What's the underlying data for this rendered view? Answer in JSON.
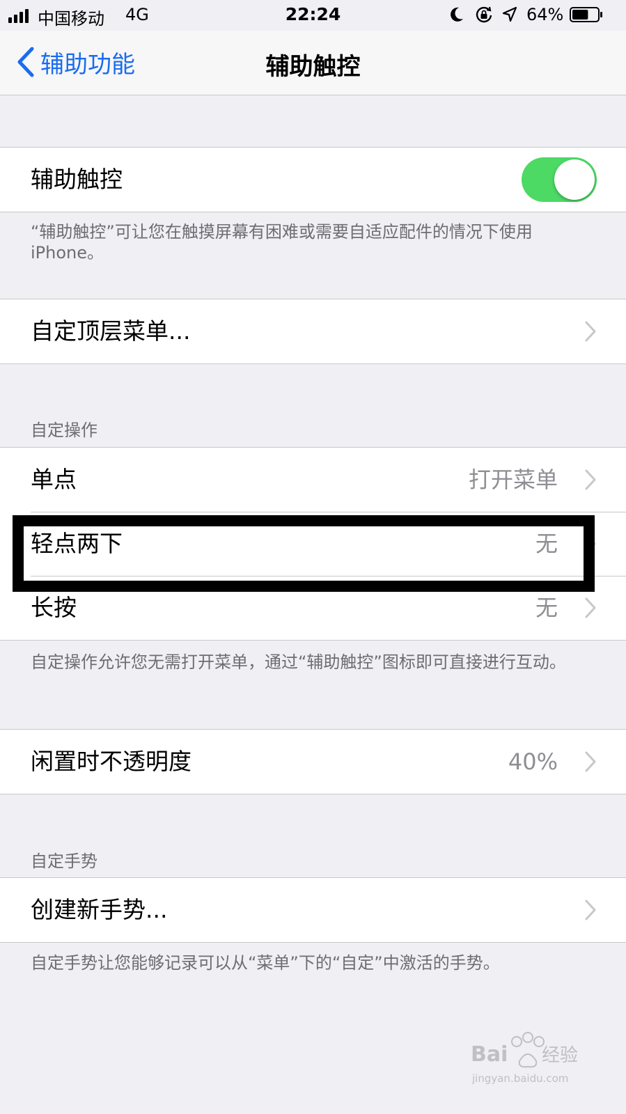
{
  "status_bar": {
    "carrier": "中国移动",
    "network": "4G",
    "time": "22:24",
    "battery": "64%",
    "battery_level": 0.64
  },
  "nav": {
    "back_label": "辅助功能",
    "title": "辅助触控"
  },
  "assistive_touch": {
    "label": "辅助触控",
    "enabled": true,
    "footer": "“辅助触控”可让您在触摸屏幕有困难或需要自适应配件的情况下使用 iPhone。"
  },
  "top_menu": {
    "label": "自定顶层菜单..."
  },
  "custom_actions": {
    "header": "自定操作",
    "items": [
      {
        "label": "单点",
        "value": "打开菜单"
      },
      {
        "label": "轻点两下",
        "value": "无"
      },
      {
        "label": "长按",
        "value": "无"
      }
    ],
    "footer": "自定操作允许您无需打开菜单，通过“辅助触控”图标即可直接进行互动。"
  },
  "idle_opacity": {
    "label": "闲置时不透明度",
    "value": "40%"
  },
  "custom_gestures": {
    "header": "自定手势",
    "create_label": "创建新手势...",
    "footer": "自定手势让您能够记录可以从“菜单”下的“自定”中激活的手势。"
  },
  "watermark": {
    "brand": "Baidu经验",
    "url": "jingyan.baidu.com"
  },
  "colors": {
    "tint": "#1a6cf0",
    "toggle_on": "#4cd964",
    "background": "#efeff4",
    "secondary_text": "#8e8e93",
    "highlight_border": "#000000"
  },
  "icons": {
    "back": "chevron-left-icon",
    "disclosure": "chevron-right-icon",
    "moon": "moon-icon",
    "rotation_lock": "rotation-lock-icon",
    "location": "location-arrow-icon",
    "battery": "battery-icon",
    "signal": "signal-bars-icon"
  }
}
